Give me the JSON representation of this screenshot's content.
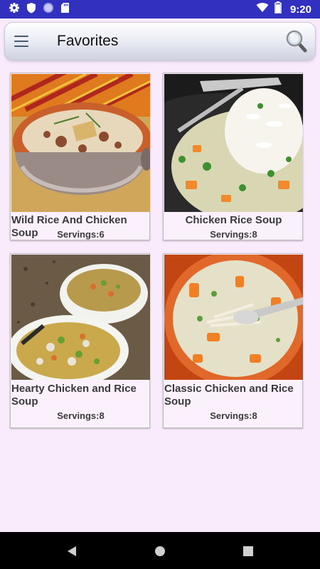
{
  "status_bar": {
    "time": "9:20",
    "left_icons": [
      "settings-icon",
      "shield-icon",
      "sync-icon",
      "sd-card-icon"
    ],
    "right_icons": [
      "wifi-icon",
      "battery-icon"
    ]
  },
  "app_bar": {
    "title": "Favorites",
    "menu_icon": "hamburger-menu-icon",
    "search_icon": "search-icon"
  },
  "recipes": [
    {
      "title": "Wild Rice And Chicken Soup",
      "servings": "Servings:6"
    },
    {
      "title": "Chicken Rice Soup",
      "servings": "Servings:8"
    },
    {
      "title": "Hearty Chicken and Rice Soup",
      "servings": "Servings:8"
    },
    {
      "title": "Classic Chicken and Rice Soup",
      "servings": "Servings:8"
    }
  ],
  "nav_bar": {
    "icons": [
      "back-icon",
      "home-icon",
      "recents-icon"
    ]
  },
  "colors": {
    "status_bar": "#3130bf",
    "background": "#f9eafc",
    "card": "#faf1fd",
    "nav_bar": "#000000"
  }
}
